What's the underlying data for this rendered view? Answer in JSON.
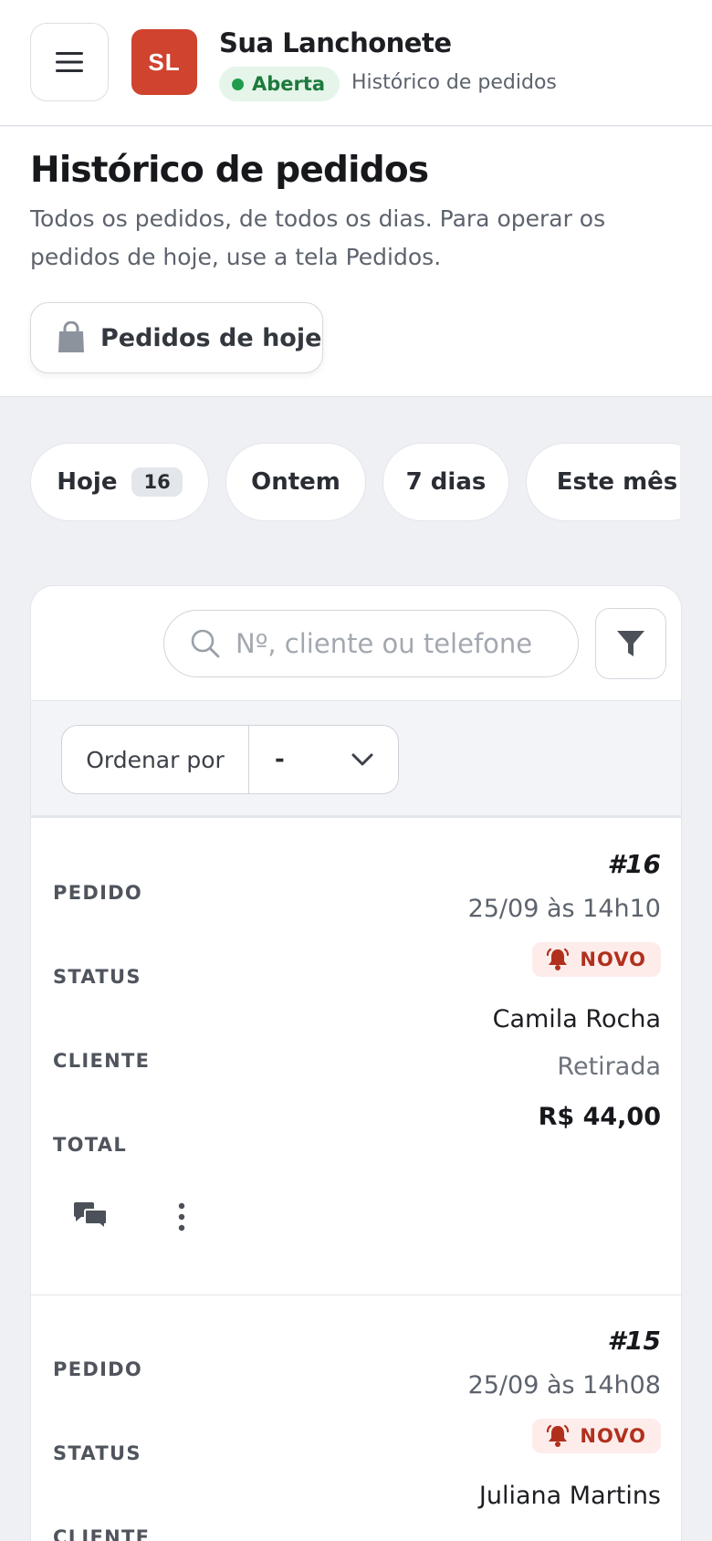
{
  "header": {
    "avatar_initials": "SL",
    "store_name": "Sua Lanchonete",
    "status_badge": "Aberta",
    "breadcrumb": "Histórico de pedidos"
  },
  "intro": {
    "title": "Histórico de pedidos",
    "description": "Todos os pedidos, de todos os dias. Para operar os pedidos de hoje, use a tela Pedidos.",
    "today_button_label": "Pedidos de hoje"
  },
  "period_chips": [
    {
      "label": "Hoje",
      "count": "16",
      "selected": true
    },
    {
      "label": "Ontem"
    },
    {
      "label": "7 dias"
    },
    {
      "label": "Este mês"
    }
  ],
  "search": {
    "placeholder": "Nº, cliente ou telefone"
  },
  "sort": {
    "label": "Ordenar por",
    "selected": "-"
  },
  "field_labels": {
    "order": "PEDIDO",
    "status": "STATUS",
    "customer": "CLIENTE",
    "total": "TOTAL"
  },
  "orders": [
    {
      "number": "#16",
      "datetime": "25/09 às 14h10",
      "status": "NOVO",
      "customer_name": "Camila Rocha",
      "customer_type": "Retirada",
      "total": "R$ 44,00"
    },
    {
      "number": "#15",
      "datetime": "25/09 às 14h08",
      "status": "NOVO",
      "customer_name": "Juliana Martins"
    }
  ],
  "icons": {
    "menu": "hamburger-menu-icon",
    "bag": "shopping-bag-icon",
    "search": "search-icon",
    "filter": "filter-funnel-icon",
    "chevron": "chevron-down-icon",
    "bell": "bell-ringing-icon",
    "chat": "chat-bubbles-icon",
    "more": "more-vertical-icon"
  },
  "colors": {
    "brand": "#d0432e",
    "open_green": "#1f9d4c",
    "status_new": "#b0301d"
  }
}
